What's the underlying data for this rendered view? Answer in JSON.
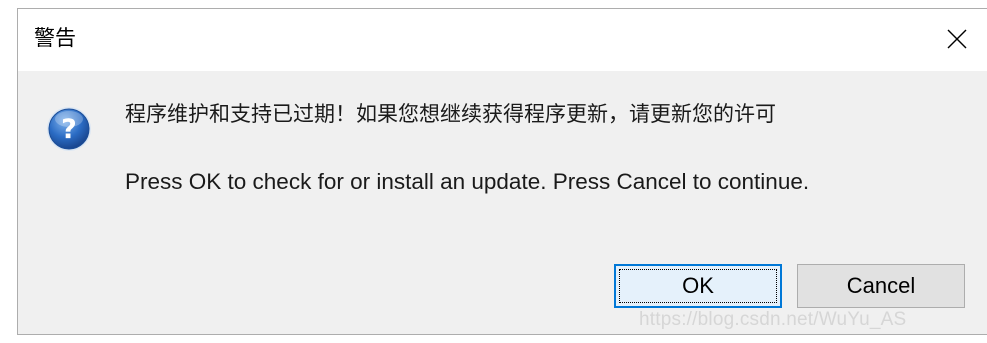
{
  "dialog": {
    "title": "警告",
    "close_icon": "close-icon",
    "icon": "question-icon",
    "message_cn": "程序维护和支持已过期！如果您想继续获得程序更新，请更新您的许可",
    "message_en": "Press OK to check for or install an update. Press Cancel to continue.",
    "buttons": {
      "ok_label": "OK",
      "cancel_label": "Cancel"
    }
  },
  "watermark": "https://blog.csdn.net/WuYu_AS",
  "colors": {
    "dialog_bg": "#f0f0f0",
    "titlebar_bg": "#ffffff",
    "button_bg": "#e1e1e1",
    "focus_border": "#0078d7",
    "icon_blue": "#2b6cc4"
  }
}
